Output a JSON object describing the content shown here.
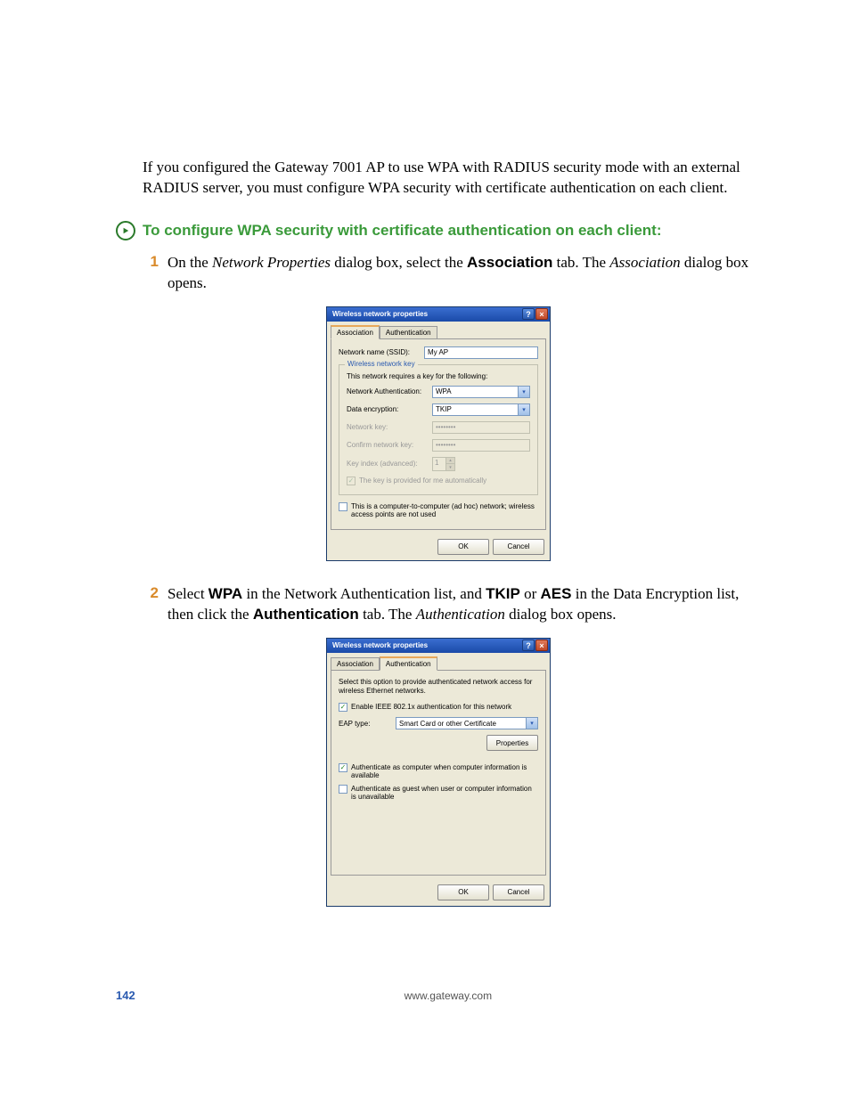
{
  "intro": "If you configured the Gateway 7001 AP to use WPA with RADIUS security mode with an external RADIUS server, you must configure WPA security with certificate authentication on each client.",
  "heading": "To configure WPA security with certificate authentication on each client:",
  "step1": {
    "num": "1",
    "pre": "On the ",
    "italic1": "Network Properties",
    "mid": " dialog box, select the ",
    "bold": "Association",
    "post": " tab. The ",
    "italic2": "Association",
    "end": " dialog box opens."
  },
  "step2": {
    "num": "2",
    "pre": "Select ",
    "b1": "WPA",
    "m1": " in the Network Authentication list, and ",
    "b2": "TKIP",
    "or": " or ",
    "b3": "AES",
    "m2": " in the Data Encryption list, then click the ",
    "b4": "Authentication",
    "m3": " tab. The ",
    "italic": "Authentication",
    "end": " dialog box opens."
  },
  "dialog1": {
    "title": "Wireless network properties",
    "tab_assoc": "Association",
    "tab_auth": "Authentication",
    "ssid_label": "Network name (SSID):",
    "ssid_value": "My AP",
    "legend": "Wireless network key",
    "hint": "This network requires a key for the following:",
    "netauth_label": "Network Authentication:",
    "netauth_value": "WPA",
    "dataenc_label": "Data encryption:",
    "dataenc_value": "TKIP",
    "netkey_label": "Network key:",
    "netkey_value": "••••••••",
    "confkey_label": "Confirm network key:",
    "confkey_value": "••••••••",
    "keyidx_label": "Key index (advanced):",
    "keyidx_value": "1",
    "autokey": "The key is provided for me automatically",
    "adhoc": "This is a computer-to-computer (ad hoc) network; wireless access points are not used",
    "ok": "OK",
    "cancel": "Cancel"
  },
  "dialog2": {
    "title": "Wireless network properties",
    "tab_assoc": "Association",
    "tab_auth": "Authentication",
    "desc": "Select this option to provide authenticated network access for wireless Ethernet networks.",
    "enable": "Enable IEEE 802.1x authentication for this network",
    "eaptype_label": "EAP type:",
    "eaptype_value": "Smart Card or other Certificate",
    "properties": "Properties",
    "authcomp": "Authenticate as computer when computer information is available",
    "authguest": "Authenticate as guest when user or computer information is unavailable",
    "ok": "OK",
    "cancel": "Cancel"
  },
  "footer": {
    "page": "142",
    "url": "www.gateway.com"
  }
}
